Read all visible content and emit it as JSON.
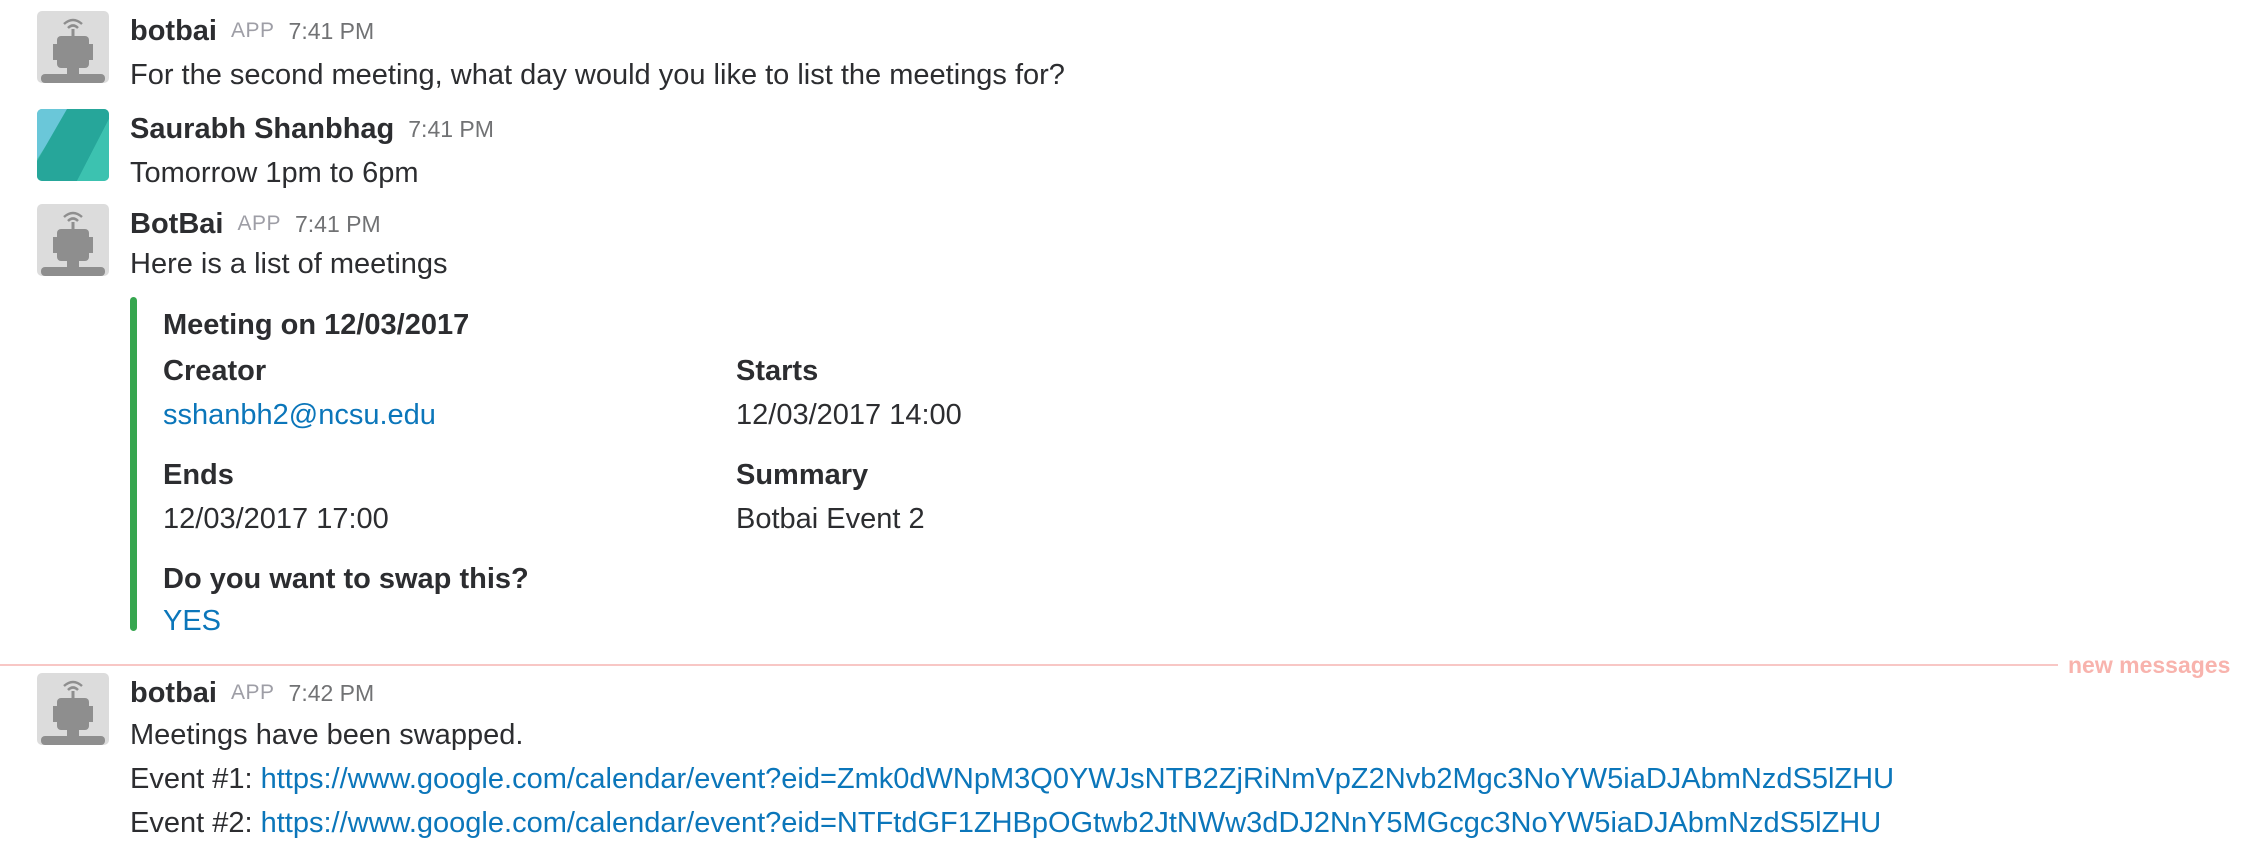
{
  "messages": [
    {
      "sender": "botbai",
      "badge": "APP",
      "time": "7:41 PM",
      "avatar_icon": "robot-icon",
      "text": "For the second meeting, what day would you like to list the meetings for?"
    },
    {
      "sender": "Saurabh Shanbhag",
      "time": "7:41 PM",
      "avatar_icon": "user-avatar-icon",
      "text": "Tomorrow 1pm to 6pm"
    },
    {
      "sender": "BotBai",
      "badge": "APP",
      "time": "7:41 PM",
      "avatar_icon": "robot-icon",
      "text": "Here is a list of meetings",
      "attachment": {
        "accent_color": "#36a64f",
        "title": "Meeting on 12/03/2017",
        "fields": [
          {
            "label": "Creator",
            "value": "sshanbh2@ncsu.edu",
            "is_link": true
          },
          {
            "label": "Starts",
            "value": "12/03/2017 14:00"
          },
          {
            "label": "Ends",
            "value": "12/03/2017 17:00"
          },
          {
            "label": "Summary",
            "value": "Botbai Event 2"
          },
          {
            "label": "Do you want to swap this?",
            "value": "YES",
            "is_link": true
          }
        ]
      }
    },
    {
      "sender": "botbai",
      "badge": "APP",
      "time": "7:42 PM",
      "avatar_icon": "robot-icon",
      "lines": [
        {
          "text": "Meetings have been swapped."
        },
        {
          "prefix": "Event #1: ",
          "link": "https://www.google.com/calendar/event?eid=Zmk0dWNpM3Q0YWJsNTB2ZjRiNmVpZ2Nvb2Mgc3NoYW5iaDJAbmNzdS5lZHU"
        },
        {
          "prefix": "Event #2: ",
          "link": "https://www.google.com/calendar/event?eid=NTFtdGF1ZHBpOGtwb2JtNWw3dDJ2NnY5MGcgc3NoYW5iaDJAbmNzdS5lZHU"
        }
      ]
    }
  ],
  "divider": {
    "label": "new messages"
  },
  "colors": {
    "link": "#0b76ba",
    "attachment_bar": "#36a64f",
    "divider": "#f8c7c5",
    "divider_text": "#f8b3ad"
  }
}
